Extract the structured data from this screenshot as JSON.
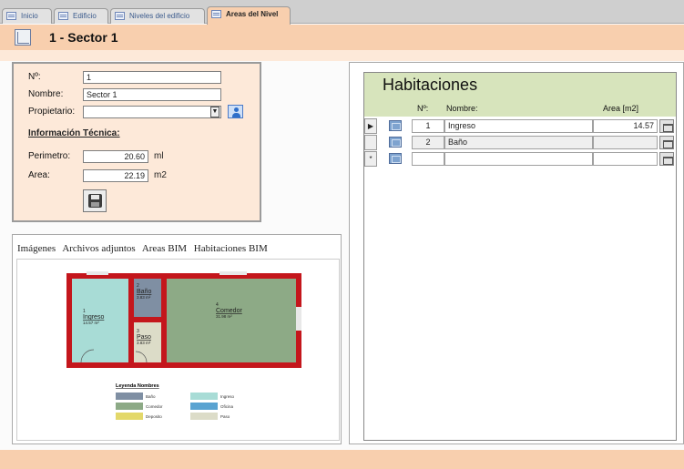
{
  "tabs": [
    {
      "label": "Inicio"
    },
    {
      "label": "Edificio"
    },
    {
      "label": "Niveles del edificio"
    },
    {
      "label": "Areas del Nivel"
    }
  ],
  "form_title": "1 -  Sector 1",
  "form": {
    "no_label": "Nº:",
    "no_value": "1",
    "nombre_label": "Nombre:",
    "nombre_value": "Sector 1",
    "propietario_label": "Propietario:",
    "propietario_value": "",
    "section_label": "Información Técnica:",
    "perimetro_label": "Perimetro:",
    "perimetro_value": "20.60",
    "perimetro_unit": "ml",
    "area_label": "Area:",
    "area_value": "22.19",
    "area_unit": "m2"
  },
  "image_tabs": [
    "Imágenes",
    "Archivos adjuntos",
    "Areas BIM",
    "Habitaciones BIM"
  ],
  "floorplan": {
    "rooms": [
      {
        "num": "1",
        "name": "Ingreso",
        "area": "14.57 m²",
        "color": "#a8dcd6"
      },
      {
        "num": "2",
        "name": "Baño",
        "area": "3.83 m²",
        "color": "#7f8fa3"
      },
      {
        "num": "3",
        "name": "Paso",
        "area": "3.83 m²",
        "color": "#dcdcc8"
      },
      {
        "num": "4",
        "name": "Comedor",
        "area": "31.98 m²",
        "color": "#8daa86"
      }
    ],
    "legend_title": "Leyenda Nombres",
    "legend": [
      {
        "label": "Baño",
        "color": "#7f8fa3"
      },
      {
        "label": "Ingreso",
        "color": "#a8dcd6"
      },
      {
        "label": "Comedor",
        "color": "#8daa86"
      },
      {
        "label": "Oficina",
        "color": "#5aa3d1"
      },
      {
        "label": "Deposito",
        "color": "#e3d86a"
      },
      {
        "label": "Paso",
        "color": "#dcdcc8"
      }
    ]
  },
  "habitaciones": {
    "title": "Habitaciones",
    "col_no": "Nº:",
    "col_nombre": "Nombre:",
    "col_area": "Area [m2]",
    "rows": [
      {
        "selector": "▶",
        "no": "1",
        "nombre": "Ingreso",
        "area": "14.57"
      },
      {
        "selector": "",
        "no": "2",
        "nombre": "Baño",
        "area": ""
      },
      {
        "selector": "*",
        "no": "",
        "nombre": "",
        "area": ""
      }
    ]
  }
}
